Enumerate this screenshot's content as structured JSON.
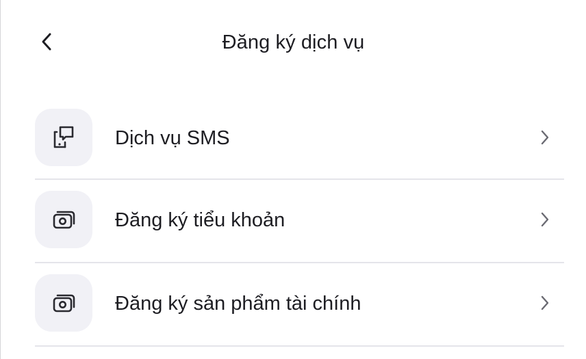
{
  "header": {
    "title": "Đăng ký dịch vụ",
    "back_icon": "chevron-left-icon"
  },
  "menu": {
    "items": [
      {
        "label": "Dịch vụ SMS",
        "icon": "phone-message-icon"
      },
      {
        "label": "Đăng ký tiểu khoản",
        "icon": "wallet-icon"
      },
      {
        "label": "Đăng ký sản phẩm tài chính",
        "icon": "wallet-icon"
      }
    ]
  },
  "colors": {
    "icon_background": "#f1f1f6",
    "divider": "#e4e4ea",
    "text": "#1d1d22",
    "chevron": "#6a6a72"
  }
}
